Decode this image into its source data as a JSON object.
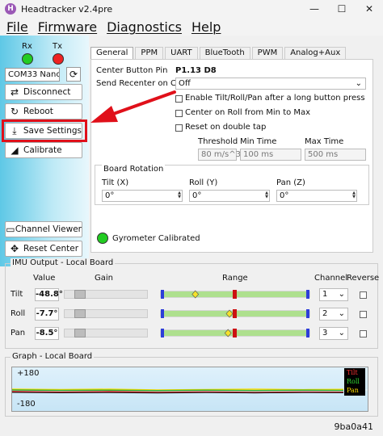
{
  "window": {
    "title": "Headtracker v2.4pre",
    "minimize_glyph": "—",
    "maximize_glyph": "☐",
    "close_glyph": "✕"
  },
  "menu": [
    "File",
    "Firmware",
    "Diagnostics",
    "Help"
  ],
  "sidebar": {
    "rx_label": "Rx",
    "tx_label": "Tx",
    "rx_color": "#22cc22",
    "tx_color": "#ee2222",
    "com_port": "COM33 Nanc",
    "buttons": {
      "disconnect": "Disconnect",
      "reboot": "Reboot",
      "save": "Save Settings",
      "calibrate": "Calibrate",
      "channel_viewer": "Channel Viewer",
      "reset_center": "Reset Center"
    }
  },
  "tabs": [
    "General",
    "PPM",
    "UART",
    "BlueTooth",
    "PWM",
    "Analog+Aux"
  ],
  "general": {
    "center_button_label": "Center Button Pin",
    "center_button_value": "P1.13 D8",
    "recenter_label": "Send Recenter on Chan",
    "recenter_value": "Off",
    "checkboxes": [
      "Enable Tilt/Roll/Pan after a long button press",
      "Center on Roll from Min to Max",
      "Reset on double tap"
    ],
    "threshold_label": "Threshold",
    "min_time_label": "Min Time",
    "max_time_label": "Max Time",
    "threshold_value": "80 m/s^3",
    "min_time_value": "100 ms",
    "max_time_value": "500 ms",
    "board_rotation": {
      "title": "Board Rotation",
      "tilt_label": "Tilt (X)",
      "roll_label": "Roll (Y)",
      "pan_label": "Pan (Z)",
      "tilt_value": "0°",
      "roll_value": "0°",
      "pan_value": "0°"
    },
    "gyro_status": "Gyrometer Calibrated",
    "gyro_color": "#22cc22"
  },
  "imu": {
    "title": "IMU Output - Local Board",
    "headers": {
      "value": "Value",
      "gain": "Gain",
      "range": "Range",
      "channel": "Channel",
      "reverse": "Reverse"
    },
    "rows": [
      {
        "axis": "Tilt",
        "value": "-48.8°",
        "channel": "1",
        "pointer_fraction": 0.22
      },
      {
        "axis": "Roll",
        "value": "-7.7°",
        "channel": "2",
        "pointer_fraction": 0.46
      },
      {
        "axis": "Pan",
        "value": "-8.5°",
        "channel": "3",
        "pointer_fraction": 0.45
      }
    ]
  },
  "graph": {
    "title": "Graph - Local Board",
    "top_label": "+180",
    "bottom_label": "-180",
    "legend": [
      {
        "name": "Tilt",
        "color": "#ff3333"
      },
      {
        "name": "Roll",
        "color": "#33dd33"
      },
      {
        "name": "Pan",
        "color": "#ffdd00"
      }
    ]
  },
  "version": "9ba0a41"
}
